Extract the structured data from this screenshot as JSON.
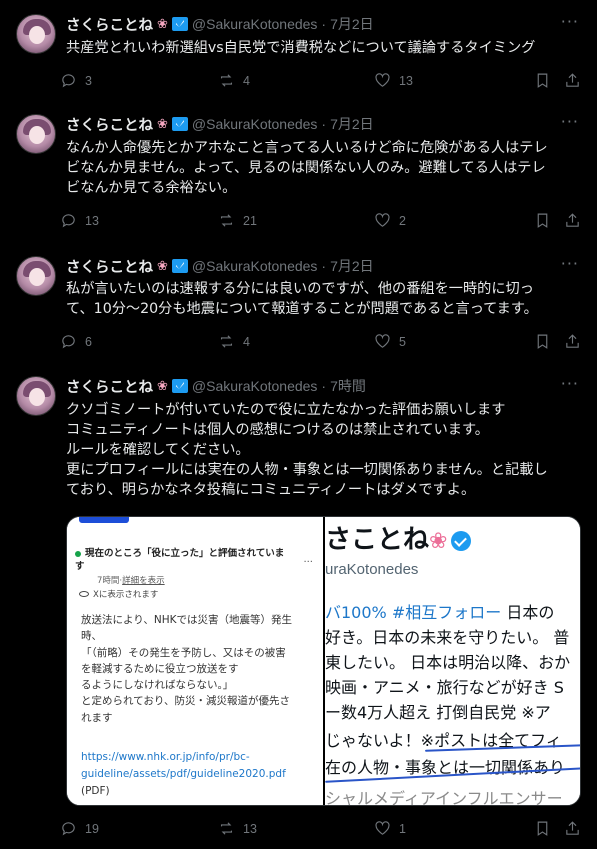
{
  "tweets": [
    {
      "name": "さくらことね",
      "handle": "@SakuraKotonedes",
      "time": "7月2日",
      "text": "共産党とれいわ新選組vs自民党で消費税などについて議論するタイミング",
      "replies": "3",
      "reposts": "4",
      "likes": "13"
    },
    {
      "name": "さくらことね",
      "handle": "@SakuraKotonedes",
      "time": "7月2日",
      "text": "なんか人命優先とかアホなこと言ってる人いるけど命に危険がある人はテレ\nビなんか見ません。よって、見るのは関係ない人のみ。避難してる人はテレ\nビなんか見てる余裕ない。",
      "replies": "13",
      "reposts": "21",
      "likes": "2"
    },
    {
      "name": "さくらことね",
      "handle": "@SakuraKotonedes",
      "time": "7月2日",
      "text": "私が言いたいのは速報する分には良いのですが、他の番組を一時的に切っ\nて、10分～20分も地震について報道することが問題であると言ってます。",
      "replies": "6",
      "reposts": "4",
      "likes": "5"
    },
    {
      "name": "さくらことね",
      "handle": "@SakuraKotonedes",
      "time": "7時間",
      "text": "クソゴミノートが付いていたので役に立たなかった評価お願いします\nコミュニティノートは個人の感想につけるのは禁止されています。\nルールを確認してください。\n更にプロフィールには実在の人物・事象とは一切関係ありません。と記載し\nており、明らかなネタ投稿にコミュニティノートはダメですよ。",
      "replies": "19",
      "reposts": "13",
      "likes": "1"
    }
  ],
  "dot": "·",
  "media": {
    "note_title": "現在のところ「役に立った」と評価されていま\nす",
    "note_time": "7時間",
    "note_sep": "·",
    "note_detail": "詳細を表示",
    "note_shown": "Xに表示されます",
    "note_body": "放送法により、NHKでは災害（地震等）発生\n時、\n「（前略）その発生を予防し、又はその被害\nを軽減するために役立つ放送をす\nるようにしなければならない。」\nと定められており、防災・減災報道が優先さ\nれます",
    "note_link": "https://www.nhk.or.jp/info/pr/bc-\nguideline/assets/pdf/guideline2020.pdf",
    "note_pdf": "(PDF)",
    "profile_name": "さことね",
    "profile_handle": "uraKotonedes",
    "profile_line1_a": "バ100%",
    "profile_line1_b": "#相互フォロー",
    "profile_line1_c": " 日本の",
    "profile_line2": "好き。日本の未来を守りたい。 普",
    "profile_line3": "東したい。 日本は明治以降、おか",
    "profile_line4": "映画・アニメ・旅行などが好き S",
    "profile_line5": "ー数4万人超え 打倒自民党 ※ア",
    "profile_line6": "じゃないよ！※ポストは全てフィ",
    "profile_line7": "在の人物・事象とは一切関係あり",
    "profile_line8": "シャルメディアインフルエンサー"
  }
}
